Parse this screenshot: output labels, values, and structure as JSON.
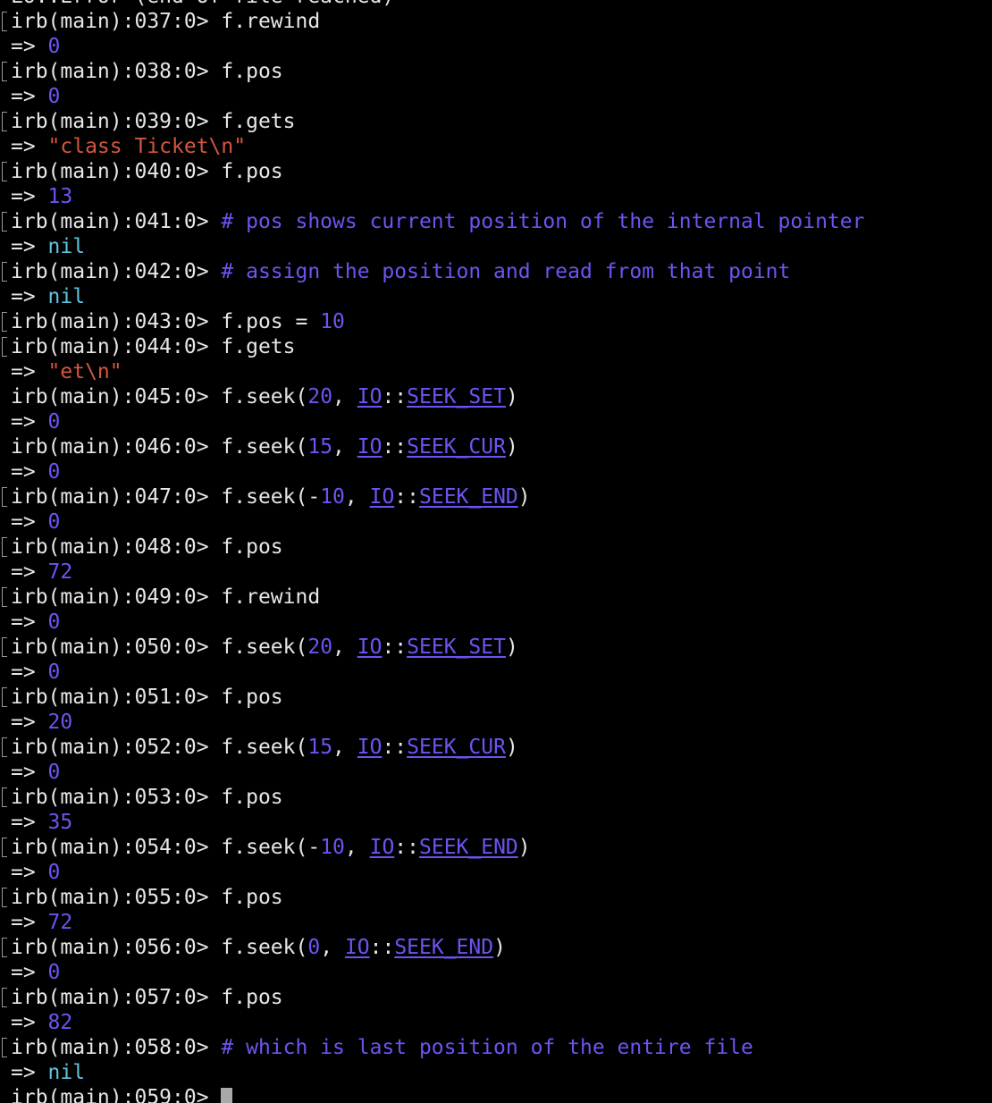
{
  "terminal": {
    "colors": {
      "background": "#000000",
      "default": "#e6e6e6",
      "number": "#6b55f2",
      "string": "#d3573f",
      "nil": "#5ec4dc",
      "comment": "#6b55f2",
      "constant": "#6b55f2",
      "cursor": "#a9a9a9"
    },
    "lines": [
      {
        "bracket": false,
        "segments": [
          {
            "t": "LO::Error (end of file reached)",
            "c": "default"
          }
        ]
      },
      {
        "bracket": true,
        "segments": [
          {
            "t": "irb(main):037:0> ",
            "c": "default"
          },
          {
            "t": "f.rewind",
            "c": "default"
          }
        ]
      },
      {
        "bracket": false,
        "segments": [
          {
            "t": "=> ",
            "c": "default"
          },
          {
            "t": "0",
            "c": "number"
          }
        ]
      },
      {
        "bracket": true,
        "segments": [
          {
            "t": "irb(main):038:0> ",
            "c": "default"
          },
          {
            "t": "f.pos",
            "c": "default"
          }
        ]
      },
      {
        "bracket": false,
        "segments": [
          {
            "t": "=> ",
            "c": "default"
          },
          {
            "t": "0",
            "c": "number"
          }
        ]
      },
      {
        "bracket": true,
        "segments": [
          {
            "t": "irb(main):039:0> ",
            "c": "default"
          },
          {
            "t": "f.gets",
            "c": "default"
          }
        ]
      },
      {
        "bracket": false,
        "segments": [
          {
            "t": "=> ",
            "c": "default"
          },
          {
            "t": "\"class Ticket\\n\"",
            "c": "string"
          }
        ]
      },
      {
        "bracket": true,
        "segments": [
          {
            "t": "irb(main):040:0> ",
            "c": "default"
          },
          {
            "t": "f.pos",
            "c": "default"
          }
        ]
      },
      {
        "bracket": false,
        "segments": [
          {
            "t": "=> ",
            "c": "default"
          },
          {
            "t": "13",
            "c": "number"
          }
        ]
      },
      {
        "bracket": true,
        "segments": [
          {
            "t": "irb(main):041:0> ",
            "c": "default"
          },
          {
            "t": "# pos shows current position of the internal pointer",
            "c": "comment"
          }
        ]
      },
      {
        "bracket": false,
        "segments": [
          {
            "t": "=> ",
            "c": "default"
          },
          {
            "t": "nil",
            "c": "nil"
          }
        ]
      },
      {
        "bracket": true,
        "segments": [
          {
            "t": "irb(main):042:0> ",
            "c": "default"
          },
          {
            "t": "# assign the position and read from that point",
            "c": "comment"
          }
        ]
      },
      {
        "bracket": false,
        "segments": [
          {
            "t": "=> ",
            "c": "default"
          },
          {
            "t": "nil",
            "c": "nil"
          }
        ]
      },
      {
        "bracket": true,
        "segments": [
          {
            "t": "irb(main):043:0> ",
            "c": "default"
          },
          {
            "t": "f.pos = ",
            "c": "default"
          },
          {
            "t": "10",
            "c": "number"
          }
        ]
      },
      {
        "bracket": true,
        "segments": [
          {
            "t": "irb(main):044:0> ",
            "c": "default"
          },
          {
            "t": "f.gets",
            "c": "default"
          }
        ]
      },
      {
        "bracket": false,
        "segments": [
          {
            "t": "=> ",
            "c": "default"
          },
          {
            "t": "\"et\\n\"",
            "c": "string"
          }
        ]
      },
      {
        "bracket": false,
        "segments": [
          {
            "t": "irb(main):045:0> ",
            "c": "default"
          },
          {
            "t": "f.seek(",
            "c": "default"
          },
          {
            "t": "20",
            "c": "number"
          },
          {
            "t": ", ",
            "c": "default"
          },
          {
            "t": "IO",
            "c": "constant",
            "u": true
          },
          {
            "t": "::",
            "c": "default"
          },
          {
            "t": "SEEK_SET",
            "c": "constant",
            "u": true
          },
          {
            "t": ")",
            "c": "default"
          }
        ]
      },
      {
        "bracket": false,
        "segments": [
          {
            "t": "=> ",
            "c": "default"
          },
          {
            "t": "0",
            "c": "number"
          }
        ]
      },
      {
        "bracket": false,
        "segments": [
          {
            "t": "irb(main):046:0> ",
            "c": "default"
          },
          {
            "t": "f.seek(",
            "c": "default"
          },
          {
            "t": "15",
            "c": "number"
          },
          {
            "t": ", ",
            "c": "default"
          },
          {
            "t": "IO",
            "c": "constant",
            "u": true
          },
          {
            "t": "::",
            "c": "default"
          },
          {
            "t": "SEEK_CUR",
            "c": "constant",
            "u": true
          },
          {
            "t": ")",
            "c": "default"
          }
        ]
      },
      {
        "bracket": false,
        "segments": [
          {
            "t": "=> ",
            "c": "default"
          },
          {
            "t": "0",
            "c": "number"
          }
        ]
      },
      {
        "bracket": true,
        "segments": [
          {
            "t": "irb(main):047:0> ",
            "c": "default"
          },
          {
            "t": "f.seek(-",
            "c": "default"
          },
          {
            "t": "10",
            "c": "number"
          },
          {
            "t": ", ",
            "c": "default"
          },
          {
            "t": "IO",
            "c": "constant",
            "u": true
          },
          {
            "t": "::",
            "c": "default"
          },
          {
            "t": "SEEK_END",
            "c": "constant",
            "u": true
          },
          {
            "t": ")",
            "c": "default"
          }
        ]
      },
      {
        "bracket": false,
        "segments": [
          {
            "t": "=> ",
            "c": "default"
          },
          {
            "t": "0",
            "c": "number"
          }
        ]
      },
      {
        "bracket": true,
        "segments": [
          {
            "t": "irb(main):048:0> ",
            "c": "default"
          },
          {
            "t": "f.pos",
            "c": "default"
          }
        ]
      },
      {
        "bracket": false,
        "segments": [
          {
            "t": "=> ",
            "c": "default"
          },
          {
            "t": "72",
            "c": "number"
          }
        ]
      },
      {
        "bracket": true,
        "segments": [
          {
            "t": "irb(main):049:0> ",
            "c": "default"
          },
          {
            "t": "f.rewind",
            "c": "default"
          }
        ]
      },
      {
        "bracket": false,
        "segments": [
          {
            "t": "=> ",
            "c": "default"
          },
          {
            "t": "0",
            "c": "number"
          }
        ]
      },
      {
        "bracket": true,
        "segments": [
          {
            "t": "irb(main):050:0> ",
            "c": "default"
          },
          {
            "t": "f.seek(",
            "c": "default"
          },
          {
            "t": "20",
            "c": "number"
          },
          {
            "t": ", ",
            "c": "default"
          },
          {
            "t": "IO",
            "c": "constant",
            "u": true
          },
          {
            "t": "::",
            "c": "default"
          },
          {
            "t": "SEEK_SET",
            "c": "constant",
            "u": true
          },
          {
            "t": ")",
            "c": "default"
          }
        ]
      },
      {
        "bracket": false,
        "segments": [
          {
            "t": "=> ",
            "c": "default"
          },
          {
            "t": "0",
            "c": "number"
          }
        ]
      },
      {
        "bracket": true,
        "segments": [
          {
            "t": "irb(main):051:0> ",
            "c": "default"
          },
          {
            "t": "f.pos",
            "c": "default"
          }
        ]
      },
      {
        "bracket": false,
        "segments": [
          {
            "t": "=> ",
            "c": "default"
          },
          {
            "t": "20",
            "c": "number"
          }
        ]
      },
      {
        "bracket": true,
        "segments": [
          {
            "t": "irb(main):052:0> ",
            "c": "default"
          },
          {
            "t": "f.seek(",
            "c": "default"
          },
          {
            "t": "15",
            "c": "number"
          },
          {
            "t": ", ",
            "c": "default"
          },
          {
            "t": "IO",
            "c": "constant",
            "u": true
          },
          {
            "t": "::",
            "c": "default"
          },
          {
            "t": "SEEK_CUR",
            "c": "constant",
            "u": true
          },
          {
            "t": ")",
            "c": "default"
          }
        ]
      },
      {
        "bracket": false,
        "segments": [
          {
            "t": "=> ",
            "c": "default"
          },
          {
            "t": "0",
            "c": "number"
          }
        ]
      },
      {
        "bracket": true,
        "segments": [
          {
            "t": "irb(main):053:0> ",
            "c": "default"
          },
          {
            "t": "f.pos",
            "c": "default"
          }
        ]
      },
      {
        "bracket": false,
        "segments": [
          {
            "t": "=> ",
            "c": "default"
          },
          {
            "t": "35",
            "c": "number"
          }
        ]
      },
      {
        "bracket": true,
        "segments": [
          {
            "t": "irb(main):054:0> ",
            "c": "default"
          },
          {
            "t": "f.seek(-",
            "c": "default"
          },
          {
            "t": "10",
            "c": "number"
          },
          {
            "t": ", ",
            "c": "default"
          },
          {
            "t": "IO",
            "c": "constant",
            "u": true
          },
          {
            "t": "::",
            "c": "default"
          },
          {
            "t": "SEEK_END",
            "c": "constant",
            "u": true
          },
          {
            "t": ")",
            "c": "default"
          }
        ]
      },
      {
        "bracket": false,
        "segments": [
          {
            "t": "=> ",
            "c": "default"
          },
          {
            "t": "0",
            "c": "number"
          }
        ]
      },
      {
        "bracket": true,
        "segments": [
          {
            "t": "irb(main):055:0> ",
            "c": "default"
          },
          {
            "t": "f.pos",
            "c": "default"
          }
        ]
      },
      {
        "bracket": false,
        "segments": [
          {
            "t": "=> ",
            "c": "default"
          },
          {
            "t": "72",
            "c": "number"
          }
        ]
      },
      {
        "bracket": true,
        "segments": [
          {
            "t": "irb(main):056:0> ",
            "c": "default"
          },
          {
            "t": "f.seek(",
            "c": "default"
          },
          {
            "t": "0",
            "c": "number"
          },
          {
            "t": ", ",
            "c": "default"
          },
          {
            "t": "IO",
            "c": "constant",
            "u": true
          },
          {
            "t": "::",
            "c": "default"
          },
          {
            "t": "SEEK_END",
            "c": "constant",
            "u": true
          },
          {
            "t": ")",
            "c": "default"
          }
        ]
      },
      {
        "bracket": false,
        "segments": [
          {
            "t": "=> ",
            "c": "default"
          },
          {
            "t": "0",
            "c": "number"
          }
        ]
      },
      {
        "bracket": true,
        "segments": [
          {
            "t": "irb(main):057:0> ",
            "c": "default"
          },
          {
            "t": "f.pos",
            "c": "default"
          }
        ]
      },
      {
        "bracket": false,
        "segments": [
          {
            "t": "=> ",
            "c": "default"
          },
          {
            "t": "82",
            "c": "number"
          }
        ]
      },
      {
        "bracket": true,
        "segments": [
          {
            "t": "irb(main):058:0> ",
            "c": "default"
          },
          {
            "t": "# which is last position of the entire file",
            "c": "comment"
          }
        ]
      },
      {
        "bracket": false,
        "segments": [
          {
            "t": "=> ",
            "c": "default"
          },
          {
            "t": "nil",
            "c": "nil"
          }
        ]
      },
      {
        "bracket": false,
        "prompt": true,
        "segments": [
          {
            "t": "irb(main):059:0> ",
            "c": "default"
          }
        ]
      }
    ]
  }
}
